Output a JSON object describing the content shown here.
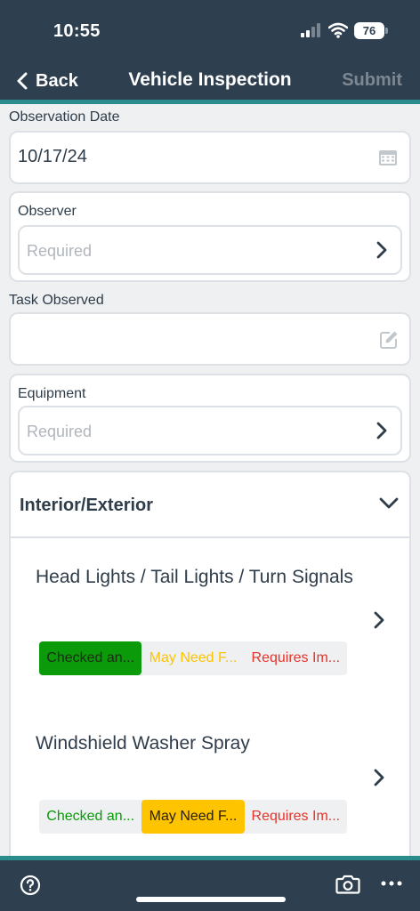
{
  "status_bar": {
    "time": "10:55",
    "battery": "76"
  },
  "nav": {
    "back_label": "Back",
    "title": "Vehicle Inspection",
    "submit_label": "Submit"
  },
  "form": {
    "observation_date": {
      "label": "Observation Date",
      "value": "10/17/24"
    },
    "observer": {
      "label": "Observer",
      "placeholder": "Required"
    },
    "task_observed": {
      "label": "Task Observed",
      "value": ""
    },
    "equipment": {
      "label": "Equipment",
      "placeholder": "Required"
    }
  },
  "section": {
    "title": "Interior/Exterior",
    "items": [
      {
        "title": "Head Lights / Tail Lights / Turn Signals",
        "options": [
          "Checked an...",
          "May Need F...",
          "Requires Im..."
        ],
        "selected": 0
      },
      {
        "title": "Windshield Washer Spray",
        "options": [
          "Checked an...",
          "May Need F...",
          "Requires Im..."
        ],
        "selected": 1
      }
    ]
  },
  "colors": {
    "header_bg": "#2e3f4f",
    "accent": "#2a8c8c",
    "ok_green": "#0a9a0a",
    "warn_yellow": "#ffc400",
    "bad_red": "#e5342b",
    "submit_disabled": "#7c8791"
  },
  "icons": [
    "calendar-icon",
    "edit-icon",
    "chevron-right-icon",
    "chevron-down-icon",
    "help-icon",
    "camera-icon",
    "more-icon"
  ]
}
